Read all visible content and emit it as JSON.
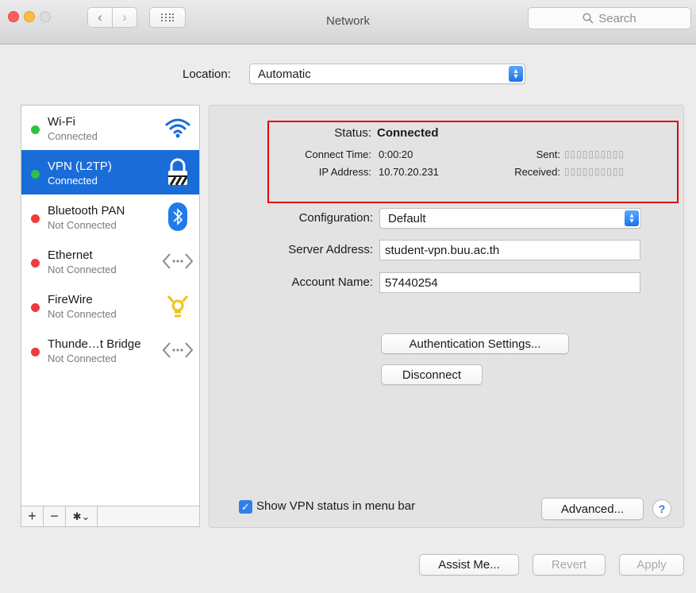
{
  "window": {
    "title": "Network"
  },
  "search": {
    "placeholder": "Search"
  },
  "location": {
    "label": "Location:",
    "value": "Automatic"
  },
  "services": [
    {
      "name": "Wi-Fi",
      "status": "Connected",
      "status_color": "#2ec240",
      "icon": "wifi-icon"
    },
    {
      "name": "VPN (L2TP)",
      "status": "Connected",
      "status_color": "#2ec240",
      "icon": "vpn-lock-icon"
    },
    {
      "name": "Bluetooth PAN",
      "status": "Not Connected",
      "status_color": "#ef3b3b",
      "icon": "bluetooth-icon"
    },
    {
      "name": "Ethernet",
      "status": "Not Connected",
      "status_color": "#ef3b3b",
      "icon": "ethernet-icon"
    },
    {
      "name": "FireWire",
      "status": "Not Connected",
      "status_color": "#ef3b3b",
      "icon": "firewire-icon"
    },
    {
      "name": "Thunde…t Bridge",
      "status": "Not Connected",
      "status_color": "#ef3b3b",
      "icon": "thunderbolt-bridge-icon"
    }
  ],
  "status": {
    "label": "Status:",
    "value": "Connected",
    "connect_time_label": "Connect Time:",
    "connect_time": "0:00:20",
    "ip_label": "IP Address:",
    "ip": "10.70.20.231",
    "sent_label": "Sent:",
    "received_label": "Received:"
  },
  "config": {
    "configuration_label": "Configuration:",
    "configuration_value": "Default",
    "server_label": "Server Address:",
    "server_value": "student-vpn.buu.ac.th",
    "account_label": "Account Name:",
    "account_value": "57440254"
  },
  "buttons": {
    "auth": "Authentication Settings...",
    "disconnect": "Disconnect",
    "advanced": "Advanced...",
    "help": "?",
    "assist": "Assist Me...",
    "revert": "Revert",
    "apply": "Apply"
  },
  "show_vpn_status": {
    "label": "Show VPN status in menu bar",
    "checked": true
  },
  "sidebar_tools": {
    "add": "+",
    "remove": "−"
  },
  "colors": {
    "accent": "#1a6cd9",
    "highlight_box": "#e30000"
  }
}
